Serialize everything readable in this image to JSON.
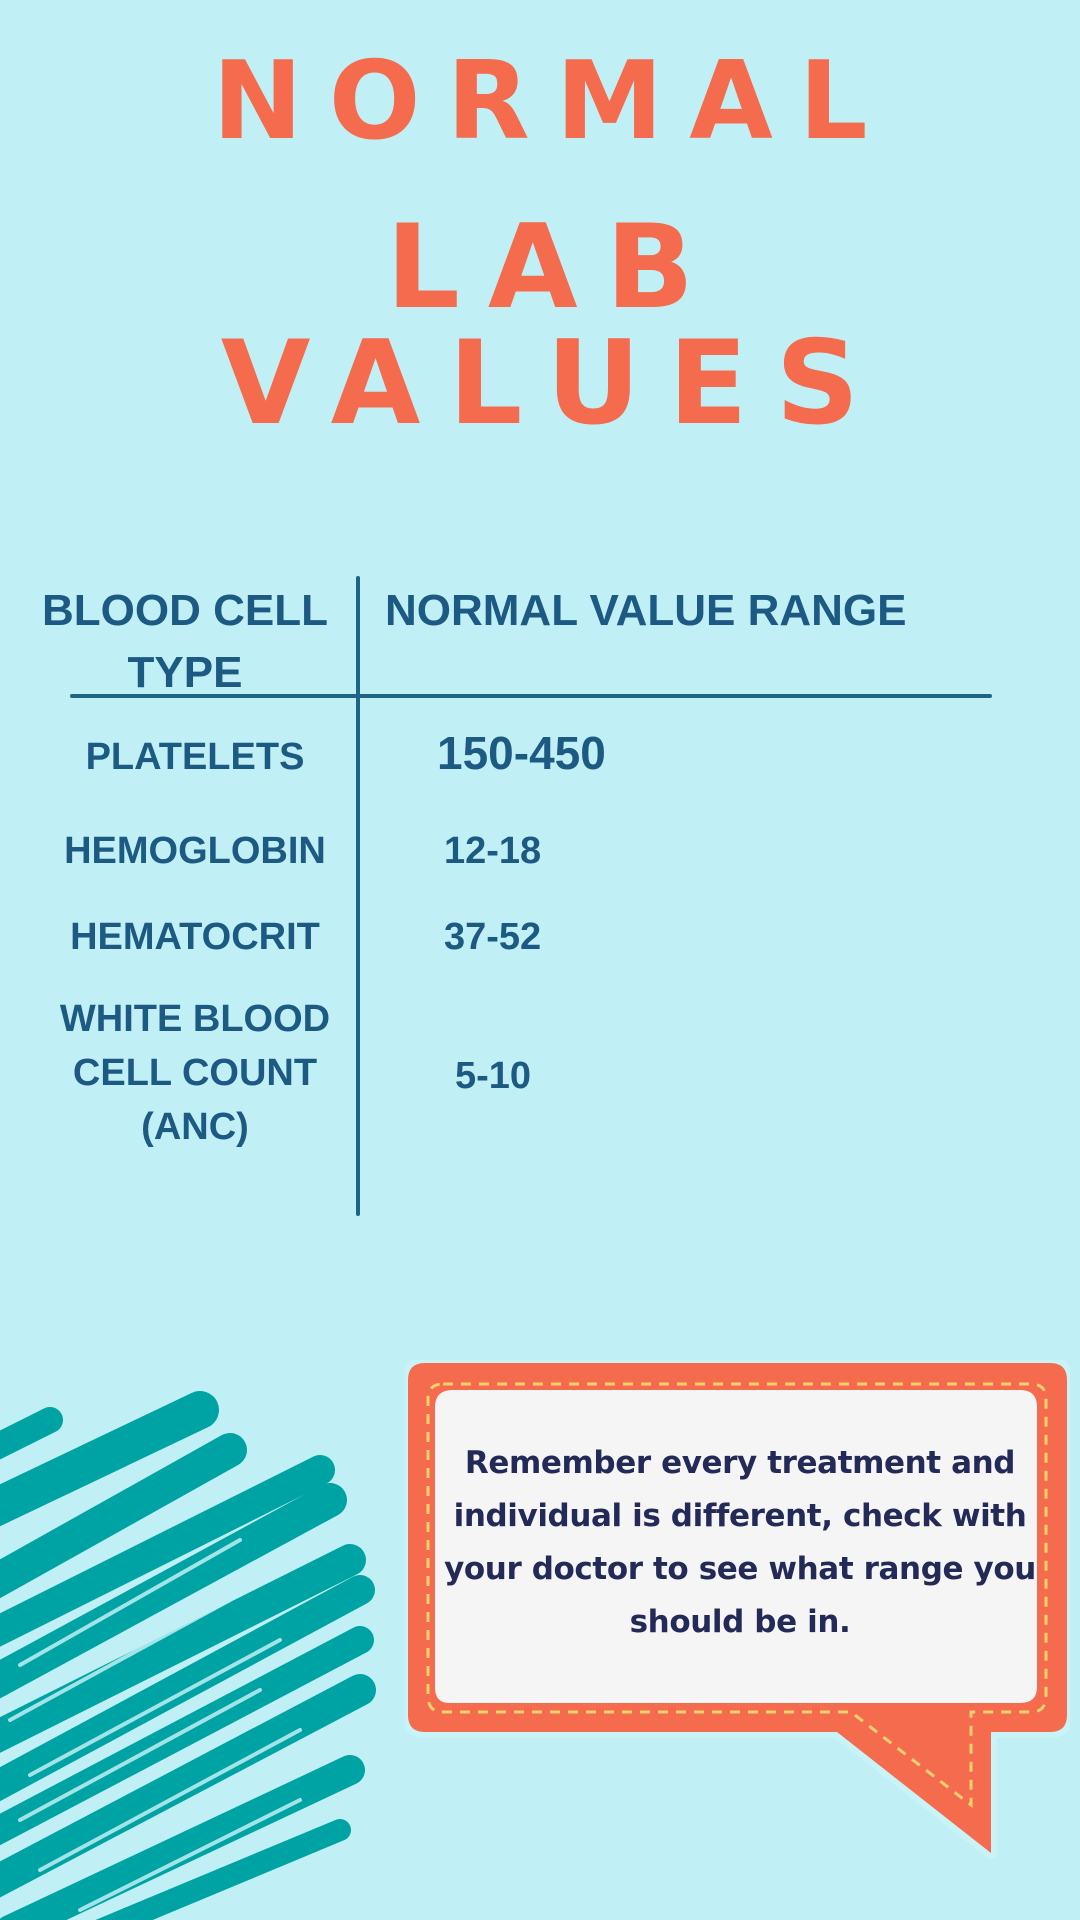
{
  "title": {
    "line1": "NORMAL",
    "line2": "LAB VALUES"
  },
  "table": {
    "headers": {
      "type": "BLOOD CELL TYPE",
      "range": "NORMAL VALUE RANGE"
    },
    "rows": [
      {
        "type": "PLATELETS",
        "range": "150-450"
      },
      {
        "type": "HEMOGLOBIN",
        "range": "12-18"
      },
      {
        "type": "HEMATOCRIT",
        "range": "37-52"
      },
      {
        "type": "WHITE BLOOD CELL COUNT (ANC)",
        "range": "5-10"
      }
    ]
  },
  "callout": {
    "text": "Remember every treatment and individual is different, check with your doctor to see what range you should be in."
  },
  "colors": {
    "background": "#c0f0f5",
    "title": "#f56b4d",
    "table_text": "#1d5a83",
    "bubble_border": "#f56b4d",
    "bubble_fill": "#f5f5f5",
    "bubble_text": "#232a57",
    "scribble": "#00a3a3"
  }
}
